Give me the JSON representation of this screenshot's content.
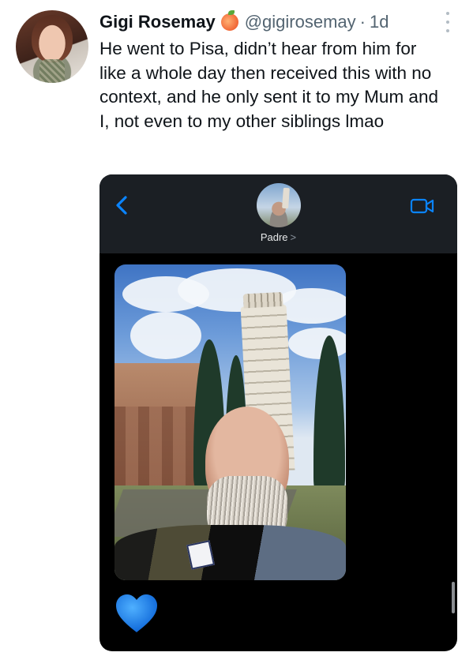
{
  "tweet": {
    "display_name": "Gigi Rosemay",
    "badge_icon": "peach-emoji-icon",
    "handle": "@gigirosemay",
    "separator": "·",
    "time": "1d",
    "text": "He went to Pisa, didn’t hear from him for like a whole day then received this with no context, and he only sent it to my Mum and I, not even to my other siblings lmao"
  },
  "media": {
    "app": "iMessage",
    "contact_name": "Padre",
    "contact_chevron": ">",
    "icons": [
      "back-chevron-icon",
      "facetime-video-icon",
      "blue-heart-icon"
    ],
    "accent_color": "#0a84ff",
    "header_bg": "#1b1f24"
  }
}
